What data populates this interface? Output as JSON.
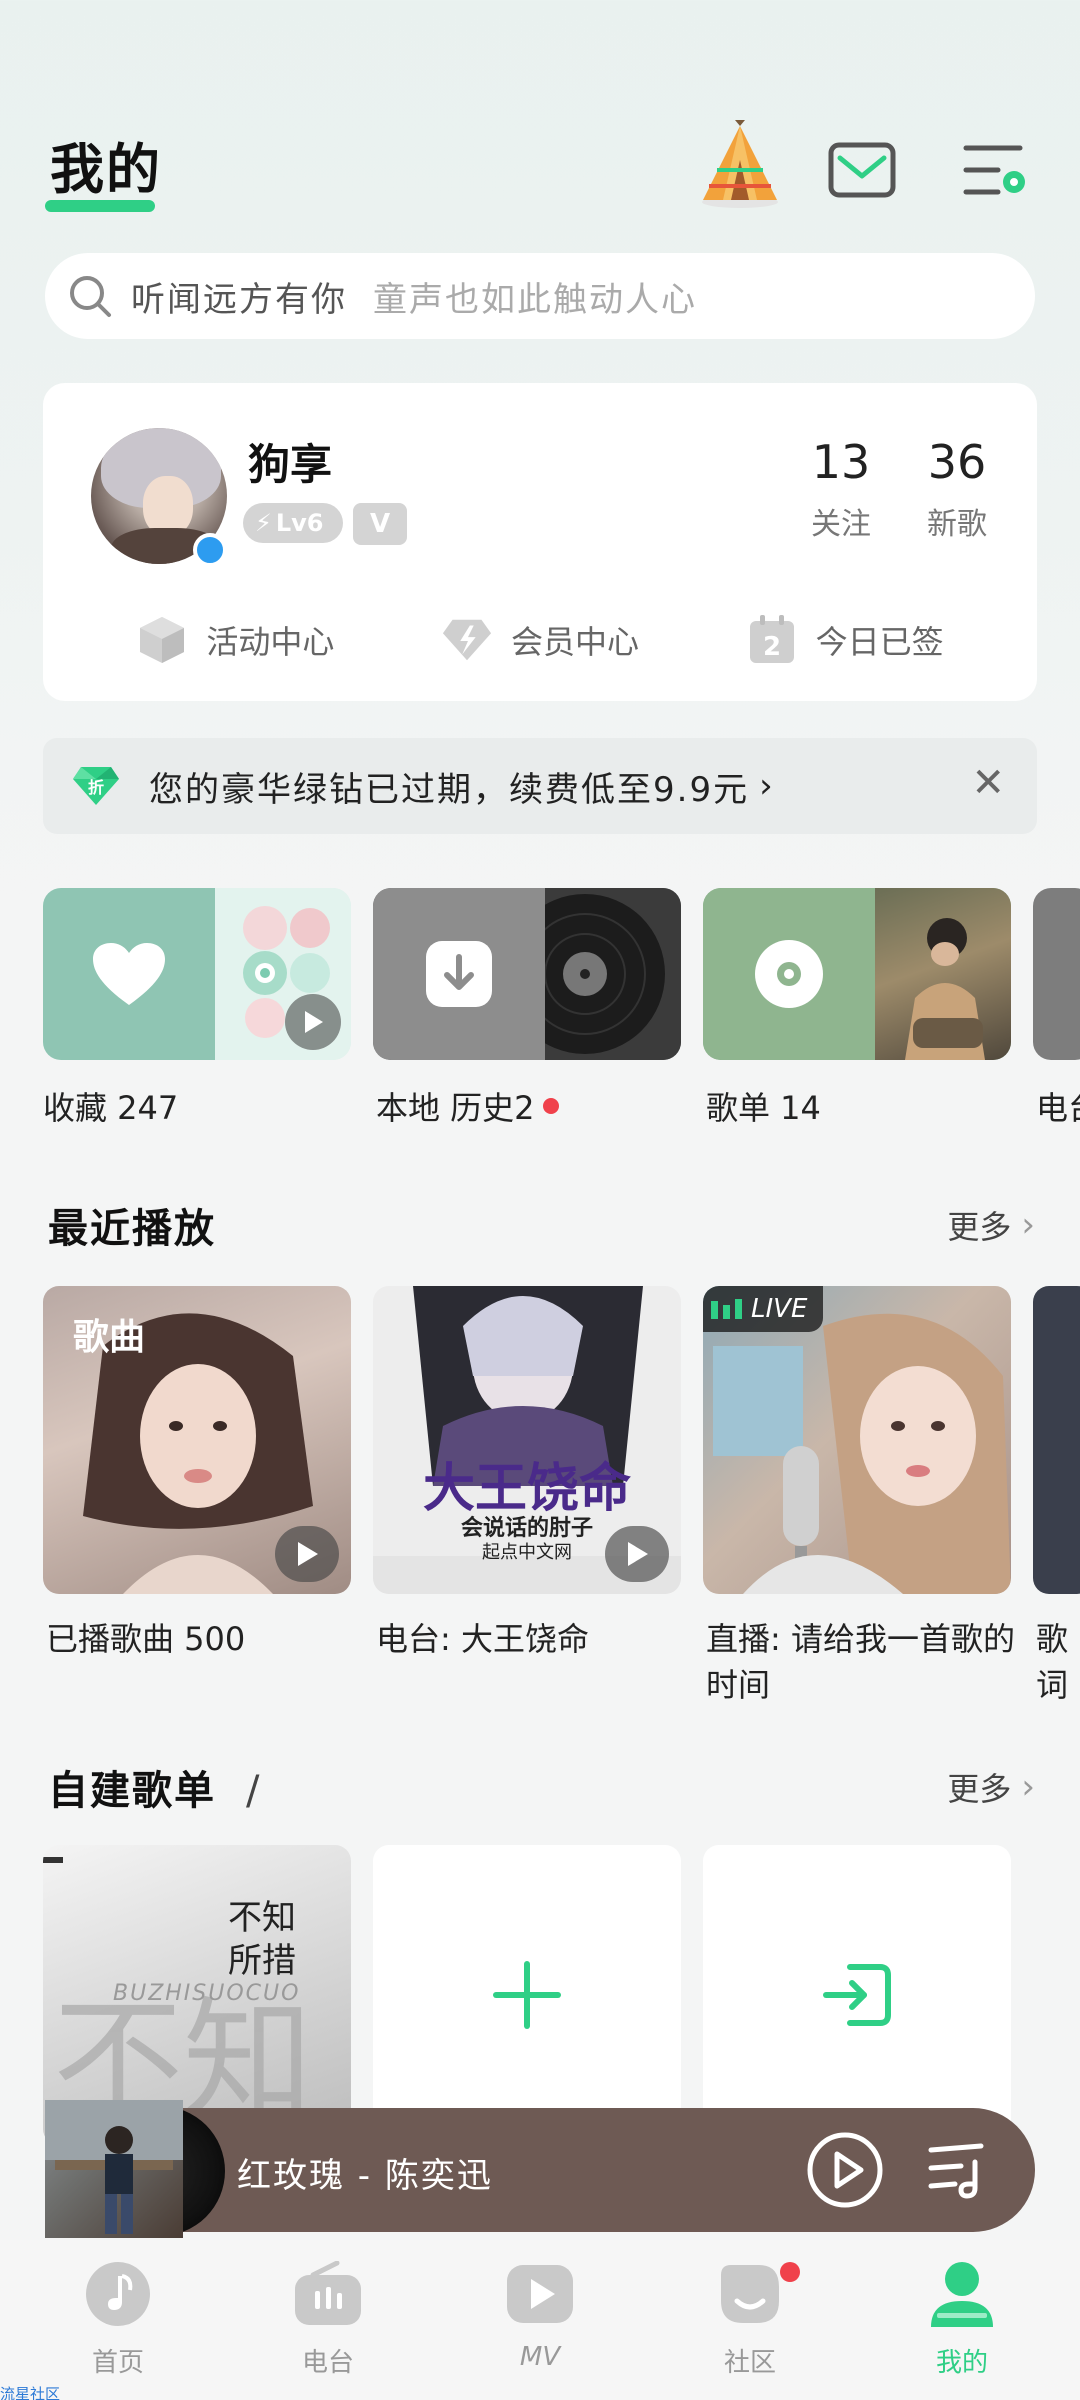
{
  "header": {
    "title": "我的"
  },
  "search": {
    "main": "听闻远方有你",
    "sub": "童声也如此触动人心"
  },
  "profile": {
    "username": "狗享",
    "level": "Lv6",
    "vip_mark": "V",
    "follow_count": "13",
    "follow_label": "关注",
    "new_songs_count": "36",
    "new_songs_label": "新歌",
    "actions": [
      {
        "label": "活动中心",
        "icon": "cube-icon"
      },
      {
        "label": "会员中心",
        "icon": "diamond-lightning-icon"
      },
      {
        "label": "今日已签",
        "icon": "calendar-icon",
        "badge": "2"
      }
    ]
  },
  "vip_banner": {
    "text": "您的豪华绿钻已过期，续费低至9.9元",
    "discount_mark": "折"
  },
  "tiles": [
    {
      "label": "收藏 247"
    },
    {
      "label": "本地 历史2",
      "has_dot": true
    },
    {
      "label": "歌单 14"
    },
    {
      "label": "电台"
    }
  ],
  "recent": {
    "title": "最近播放",
    "more": "更多",
    "cards": [
      {
        "tag": "歌曲",
        "caption": "已播歌曲 500"
      },
      {
        "cover_title": "大王饶命",
        "cover_subtitle": "会说话的肘子",
        "cover_publisher": "起点中文网",
        "caption": "电台: 大王饶命"
      },
      {
        "live_tag": "LIVE",
        "caption": "直播: 请给我一首歌的时间"
      },
      {
        "caption": "歌词"
      }
    ]
  },
  "playlists": {
    "title": "自建歌单",
    "title_suffix": "/",
    "more": "更多",
    "first_cover": {
      "title_line1": "不知",
      "title_line2": "所措",
      "title_pinyin": "BUZHISUOCUO"
    }
  },
  "mini_player": {
    "title": "红玫瑰 - 陈奕迅"
  },
  "bottom_nav": [
    {
      "label": "首页",
      "icon": "music-note-icon"
    },
    {
      "label": "电台",
      "icon": "radio-icon"
    },
    {
      "label": "MV",
      "icon": "video-play-icon"
    },
    {
      "label": "社区",
      "icon": "community-icon",
      "has_dot": true
    },
    {
      "label": "我的",
      "icon": "person-icon",
      "active": true
    }
  ],
  "corner_text": "流星社区",
  "colors": {
    "accent": "#2fcf86",
    "badge_red": "#f0414b",
    "player_bg": "#6e5a54"
  }
}
